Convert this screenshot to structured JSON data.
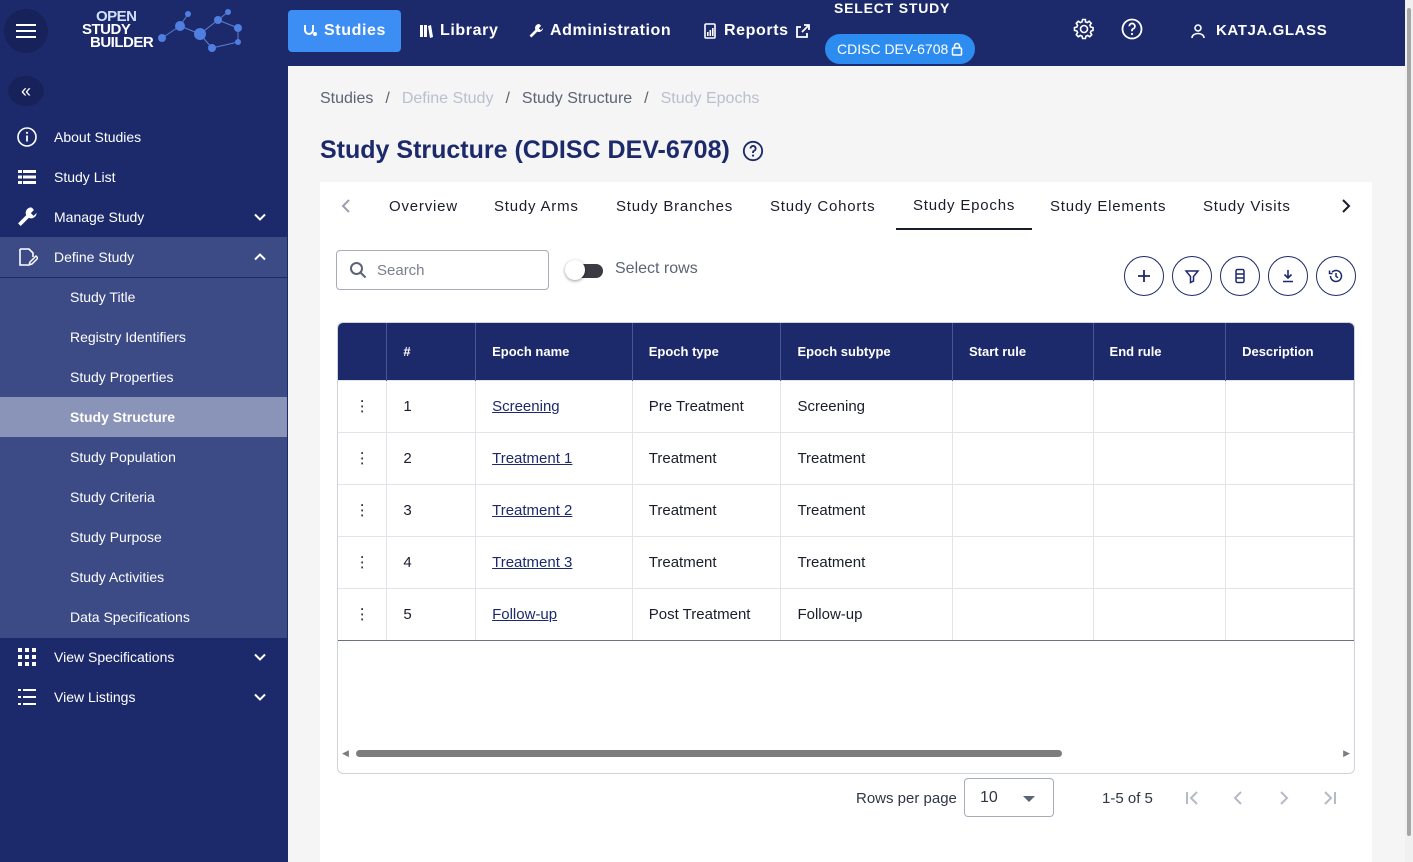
{
  "topbar": {
    "logo": {
      "line1": "OPEN",
      "line2": "STUDY",
      "line3": "BUILDER"
    },
    "nav": [
      {
        "label": "Studies",
        "icon": "stethoscope-icon",
        "active": true
      },
      {
        "label": "Library",
        "icon": "library-icon",
        "active": false
      },
      {
        "label": "Administration",
        "icon": "wrench-icon",
        "active": false
      },
      {
        "label": "Reports",
        "icon": "report-icon",
        "active": false
      }
    ],
    "select_study_label": "SELECT STUDY",
    "study_chip": "CDISC DEV-6708",
    "user_name": "KATJA.GLASS"
  },
  "sidebar": {
    "items": [
      {
        "label": "About Studies",
        "icon": "info-icon"
      },
      {
        "label": "Study List",
        "icon": "list-icon"
      },
      {
        "label": "Manage Study",
        "icon": "wrench-icon"
      },
      {
        "label": "Define Study",
        "icon": "edit-document-icon"
      },
      {
        "label": "View Specifications",
        "icon": "grid-icon"
      },
      {
        "label": "View Listings",
        "icon": "listing-icon"
      }
    ],
    "define_sub": [
      "Study Title",
      "Registry Identifiers",
      "Study Properties",
      "Study Structure",
      "Study Population",
      "Study Criteria",
      "Study Purpose",
      "Study Activities",
      "Data Specifications"
    ],
    "selected_sub": "Study Structure"
  },
  "breadcrumb": [
    "Studies",
    "Define Study",
    "Study Structure",
    "Study Epochs"
  ],
  "page_title": "Study Structure (CDISC DEV-6708)",
  "tabs": [
    "Overview",
    "Study Arms",
    "Study Branches",
    "Study Cohorts",
    "Study Epochs",
    "Study Elements",
    "Study Visits"
  ],
  "active_tab": "Study Epochs",
  "search": {
    "placeholder": "Search"
  },
  "select_rows_label": "Select rows",
  "table": {
    "headers": [
      "#",
      "Epoch name",
      "Epoch type",
      "Epoch subtype",
      "Start rule",
      "End rule",
      "Description"
    ],
    "rows": [
      {
        "num": "1",
        "name": "Screening",
        "type": "Pre Treatment",
        "subtype": "Screening",
        "start": "",
        "end": "",
        "desc": ""
      },
      {
        "num": "2",
        "name": "Treatment 1",
        "type": "Treatment",
        "subtype": "Treatment",
        "start": "",
        "end": "",
        "desc": ""
      },
      {
        "num": "3",
        "name": "Treatment 2",
        "type": "Treatment",
        "subtype": "Treatment",
        "start": "",
        "end": "",
        "desc": ""
      },
      {
        "num": "4",
        "name": "Treatment 3",
        "type": "Treatment",
        "subtype": "Treatment",
        "start": "",
        "end": "",
        "desc": ""
      },
      {
        "num": "5",
        "name": "Follow-up",
        "type": "Post Treatment",
        "subtype": "Follow-up",
        "start": "",
        "end": "",
        "desc": ""
      }
    ]
  },
  "pagination": {
    "rows_per_page_label": "Rows per page",
    "rows_per_page": "10",
    "range": "1-5 of 5"
  },
  "colors": {
    "primary": "#1c2a6b",
    "accent": "#3d8ef4"
  }
}
